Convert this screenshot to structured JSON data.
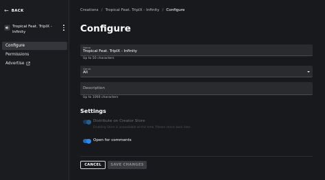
{
  "sidebar": {
    "back_label": "BACK",
    "asset_title": "Tropical Feat. TriplX - Infinity",
    "asset_icon": "speaker-icon",
    "items": [
      {
        "label": "Configure",
        "active": true
      },
      {
        "label": "Permissions",
        "active": false
      },
      {
        "label": "Advertise",
        "active": false,
        "icon": "external-link-icon"
      }
    ]
  },
  "breadcrumb": {
    "items": [
      "Creations",
      "Tropical Feat. TriplX - Infinity",
      "Configure"
    ],
    "separator": "/"
  },
  "page": {
    "title": "Configure"
  },
  "form": {
    "name": {
      "label": "Name",
      "value": "Tropical Feat. TriplX - Infinity",
      "helper": "Up to 50 characters"
    },
    "genre": {
      "label": "Genre",
      "value": "All"
    },
    "description": {
      "placeholder": "Description",
      "value": "",
      "helper": "Up to 1000 characters"
    }
  },
  "settings": {
    "title": "Settings",
    "distribute": {
      "label": "Distribute on Creator Store",
      "sublabel": "Enabling Store is unavailable at this time. Please check back later.",
      "enabled": true,
      "disabled": true
    },
    "comments": {
      "label": "Open for comments",
      "enabled": true
    }
  },
  "actions": {
    "cancel_label": "CANCEL",
    "save_label": "SAVE CHANGES"
  },
  "colors": {
    "background": "#18191c",
    "field": "#2a2b2f",
    "accent": "#2f86e8"
  }
}
